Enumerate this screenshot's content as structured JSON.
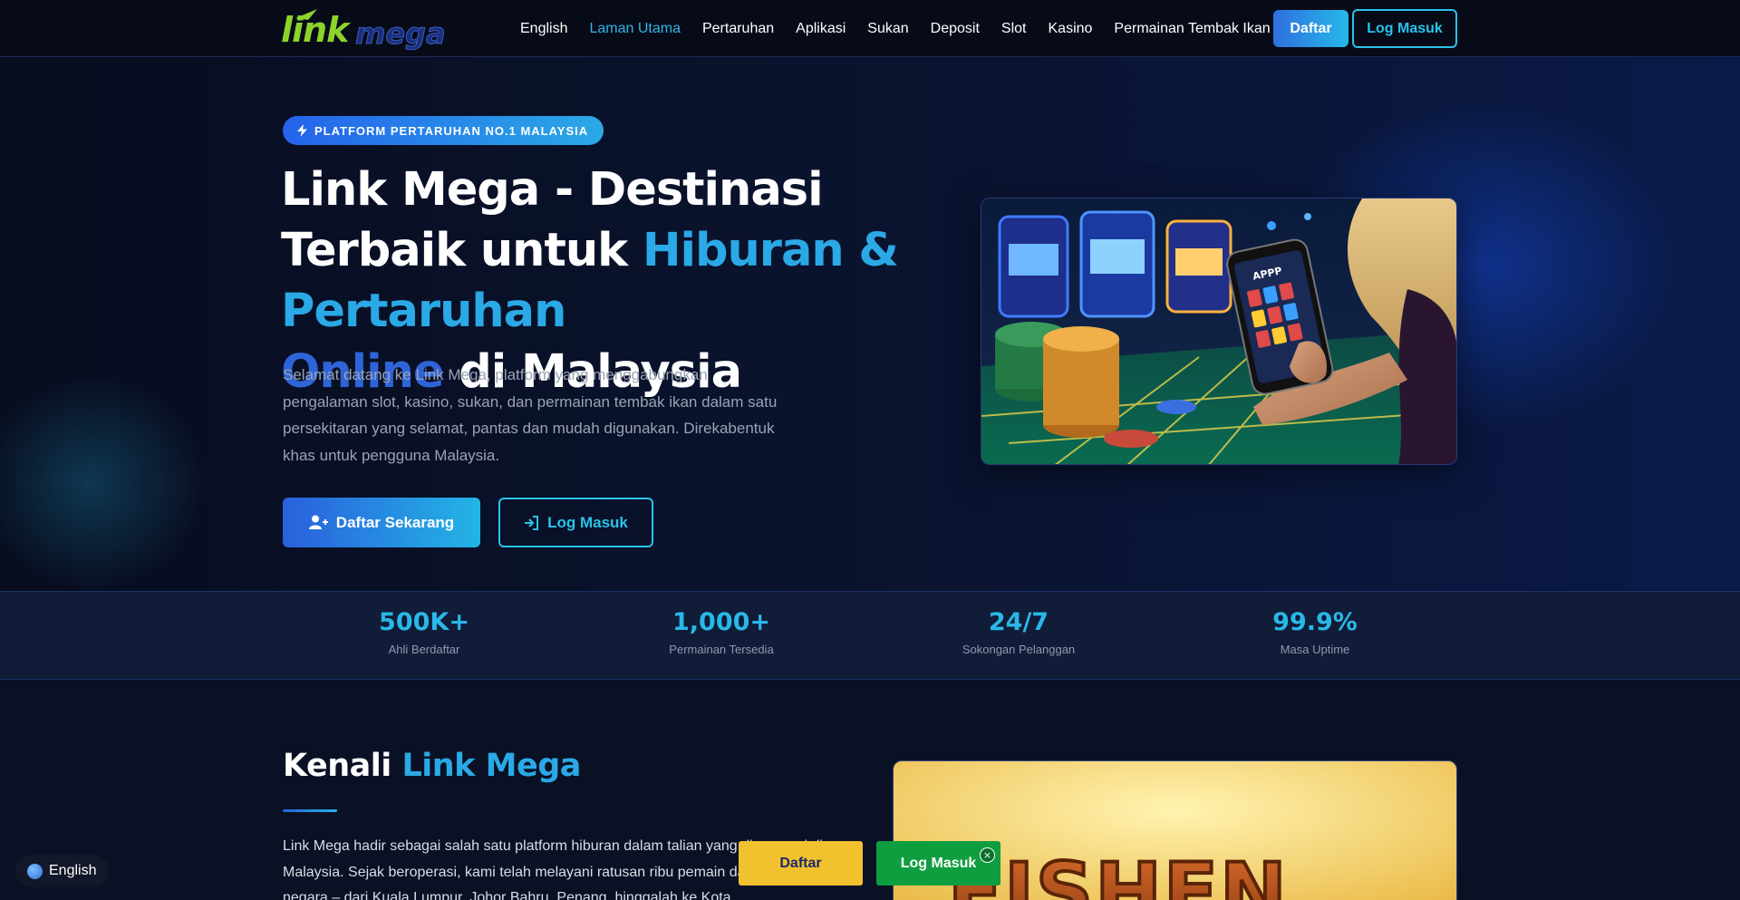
{
  "nav": {
    "logo_text": "linkmega",
    "links": [
      "English",
      "Laman Utama",
      "Pertaruhan",
      "Aplikasi",
      "Sukan",
      "Deposit",
      "Slot",
      "Kasino",
      "Permainan Tembak Ikan"
    ],
    "active_link": "Laman Utama",
    "daftar_label": "Daftar",
    "login_label": "Log Masuk"
  },
  "hero": {
    "badge_icon": "bolt-icon",
    "badge": "PLATFORM PERTARUHAN NO.1 MALAYSIA",
    "headline_part1": "Link Mega - Destinasi Terbaik untuk ",
    "headline_highlight1": "Hiburan & Pertaruhan",
    "headline_highlight2": "Online",
    "headline_part2": " di Malaysia",
    "description": "Selamat datang ke Link Mega, platform yang menggabungkan pengalaman slot, kasino, sukan, dan permainan tembak ikan dalam satu persekitaran yang selamat, pantas dan mudah digunakan. Direkabentuk khas untuk pengguna Malaysia.",
    "primary_button": "Daftar Sekarang",
    "primary_icon": "user-plus-icon",
    "secondary_button": "Log Masuk",
    "secondary_icon": "sign-in-icon",
    "image_label": "APPP"
  },
  "stats": [
    {
      "value": "500K+",
      "label": "Ahli Berdaftar"
    },
    {
      "value": "1,000+",
      "label": "Permainan Tersedia"
    },
    {
      "value": "24/7",
      "label": "Sokongan Pelanggan"
    },
    {
      "value": "99.9%",
      "label": "Masa Uptime"
    }
  ],
  "about": {
    "title_plain": "Kenali ",
    "title_accent": "Link Mega",
    "text": "Link Mega hadir sebagai salah satu platform hiburan dalam talian yang dipercayai di Malaysia. Sejak beroperasi, kami telah melayani ratusan ribu pemain dari seluruh negara – dari Kuala Lumpur, Johor Bahru, Penang, hinggalah ke Kota",
    "image_text": "FISHEN"
  },
  "floating": {
    "language": "English",
    "daftar": "Daftar",
    "login": "Log Masuk",
    "close": "×"
  },
  "colors": {
    "background": "#0b1124",
    "accent_cyan": "#29c3ea",
    "accent_blue": "#2f64d8",
    "stat_value": "#29b8e8",
    "float_yellow": "#f2c12e",
    "float_green": "#0f9e3f"
  }
}
